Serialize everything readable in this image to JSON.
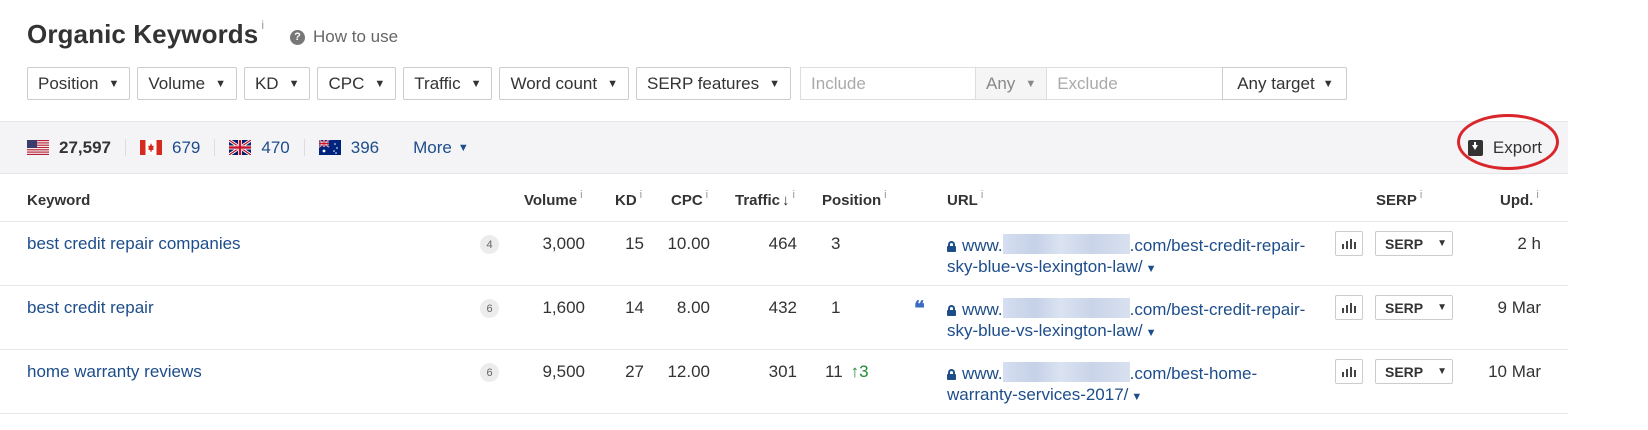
{
  "header": {
    "title": "Organic Keywords",
    "title_info": "i",
    "how_to_use": "How to use"
  },
  "filters": {
    "buttons": [
      "Position",
      "Volume",
      "KD",
      "CPC",
      "Traffic",
      "Word count",
      "SERP features"
    ],
    "include_placeholder": "Include",
    "any_label": "Any",
    "exclude_placeholder": "Exclude",
    "target_label": "Any target"
  },
  "countries": [
    {
      "flag": "us-flag",
      "count": "27,597"
    },
    {
      "flag": "ca-flag",
      "count": "679"
    },
    {
      "flag": "gb-flag",
      "count": "470"
    },
    {
      "flag": "au-flag",
      "count": "396"
    }
  ],
  "more_label": "More",
  "export_label": "Export",
  "columns": {
    "keyword": "Keyword",
    "volume": "Volume",
    "kd": "KD",
    "cpc": "CPC",
    "traffic": "Traffic",
    "position": "Position",
    "url": "URL",
    "serp": "SERP",
    "updated": "Upd.",
    "info": "i"
  },
  "rows": [
    {
      "keyword": "best credit repair companies",
      "features": "4",
      "volume": "3,000",
      "kd": "15",
      "cpc": "10.00",
      "traffic": "464",
      "position": "3",
      "position_change": "",
      "url_prefix": "www.",
      "url_suffix": ".com/best-credit-repair-sky-blue-vs-lexington-law/",
      "serp_label": "SERP",
      "updated": "2 h"
    },
    {
      "keyword": "best credit repair",
      "features": "6",
      "volume": "1,600",
      "kd": "14",
      "cpc": "8.00",
      "traffic": "432",
      "position": "1",
      "position_change": "",
      "quote": "❝",
      "url_prefix": "www.",
      "url_suffix": ".com/best-credit-repair-sky-blue-vs-lexington-law/",
      "serp_label": "SERP",
      "updated": "9 Mar"
    },
    {
      "keyword": "home warranty reviews",
      "features": "6",
      "volume": "9,500",
      "kd": "27",
      "cpc": "12.00",
      "traffic": "301",
      "position": "11",
      "position_change": "↑3",
      "url_prefix": "www.",
      "url_suffix": ".com/best-home-warranty-services-2017/",
      "serp_label": "SERP",
      "updated": "10 Mar"
    }
  ],
  "colors": {
    "link": "#1d4d8a",
    "positive": "#1e8a35",
    "highlight_circle": "#d9262b"
  }
}
